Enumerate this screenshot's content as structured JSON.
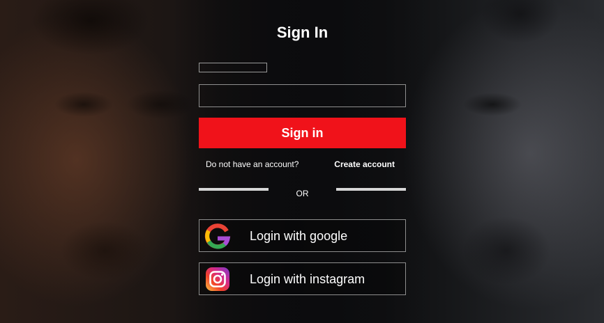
{
  "page": {
    "title": "Sign In"
  },
  "form": {
    "username_placeholder": "",
    "password_placeholder": "",
    "signin_label": "Sign in",
    "no_account_text": "Do not have an account?",
    "create_account_label": "Create account",
    "divider_text": "OR"
  },
  "social": {
    "google_label": "Login with google",
    "google_icon": "google-icon",
    "instagram_label": "Login with instagram",
    "instagram_icon": "instagram-icon"
  },
  "colors": {
    "accent": "#f0121a",
    "text": "#ffffff",
    "border": "#8e8e8e",
    "divider": "#d6d6d6"
  }
}
